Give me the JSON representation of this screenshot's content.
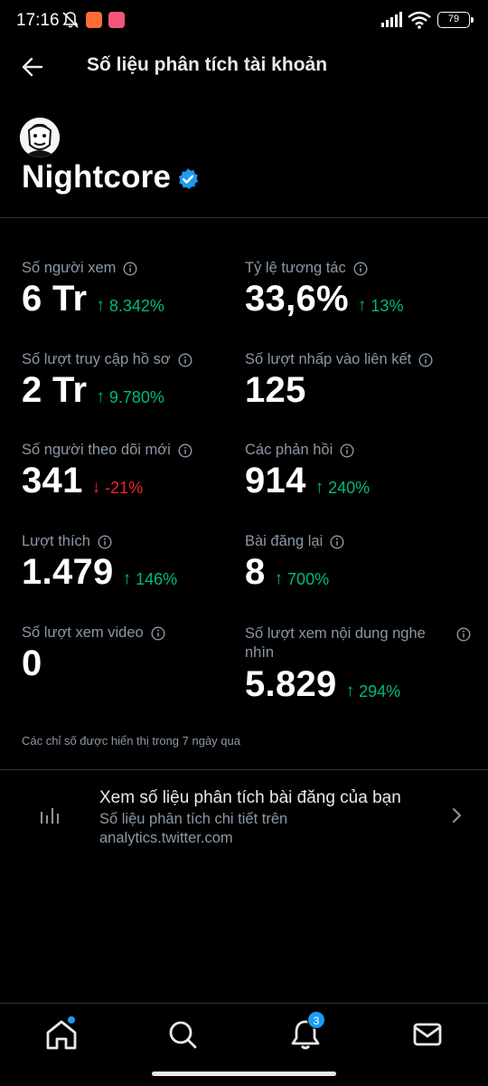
{
  "status_bar": {
    "time": "17:16",
    "battery": "79"
  },
  "header": {
    "title": "Số liệu phân tích tài khoản"
  },
  "profile": {
    "name": "Nightcore",
    "verified_color": "#1d9bf0"
  },
  "metrics": [
    {
      "label": "Số người xem",
      "value": "6 Tr",
      "change": "8.342%",
      "direction": "up"
    },
    {
      "label": "Tỷ lệ tương tác",
      "value": "33,6%",
      "change": "13%",
      "direction": "up"
    },
    {
      "label": "Số lượt truy cập hồ sơ",
      "value": "2 Tr",
      "change": "9.780%",
      "direction": "up"
    },
    {
      "label": "Số lượt nhấp vào liên kết",
      "value": "125",
      "change": "",
      "direction": ""
    },
    {
      "label": "Số người theo dõi mới",
      "value": "341",
      "change": "-21%",
      "direction": "down"
    },
    {
      "label": "Các phản hồi",
      "value": "914",
      "change": "240%",
      "direction": "up"
    },
    {
      "label": "Lượt thích",
      "value": "1.479",
      "change": "146%",
      "direction": "up"
    },
    {
      "label": "Bài đăng lại",
      "value": "8",
      "change": "700%",
      "direction": "up"
    },
    {
      "label": "Số lượt xem video",
      "value": "0",
      "change": "",
      "direction": ""
    },
    {
      "label": "Số lượt xem nội dung nghe nhìn",
      "value": "5.829",
      "change": "294%",
      "direction": "up"
    }
  ],
  "footnote": "Các chỉ số được hiển thị trong 7 ngày qua",
  "post_analytics": {
    "title": "Xem số liệu phân tích bài đăng của bạn",
    "subtitle": "Số liệu phân tích chi tiết trên analytics.twitter.com"
  },
  "bottom_nav": {
    "items": [
      "home-icon",
      "search-icon",
      "notifications-icon",
      "messages-icon"
    ],
    "notifications_badge": "3"
  },
  "colors": {
    "up": "#00ba7c",
    "down": "#f4212e",
    "accent": "#1d9bf0"
  }
}
